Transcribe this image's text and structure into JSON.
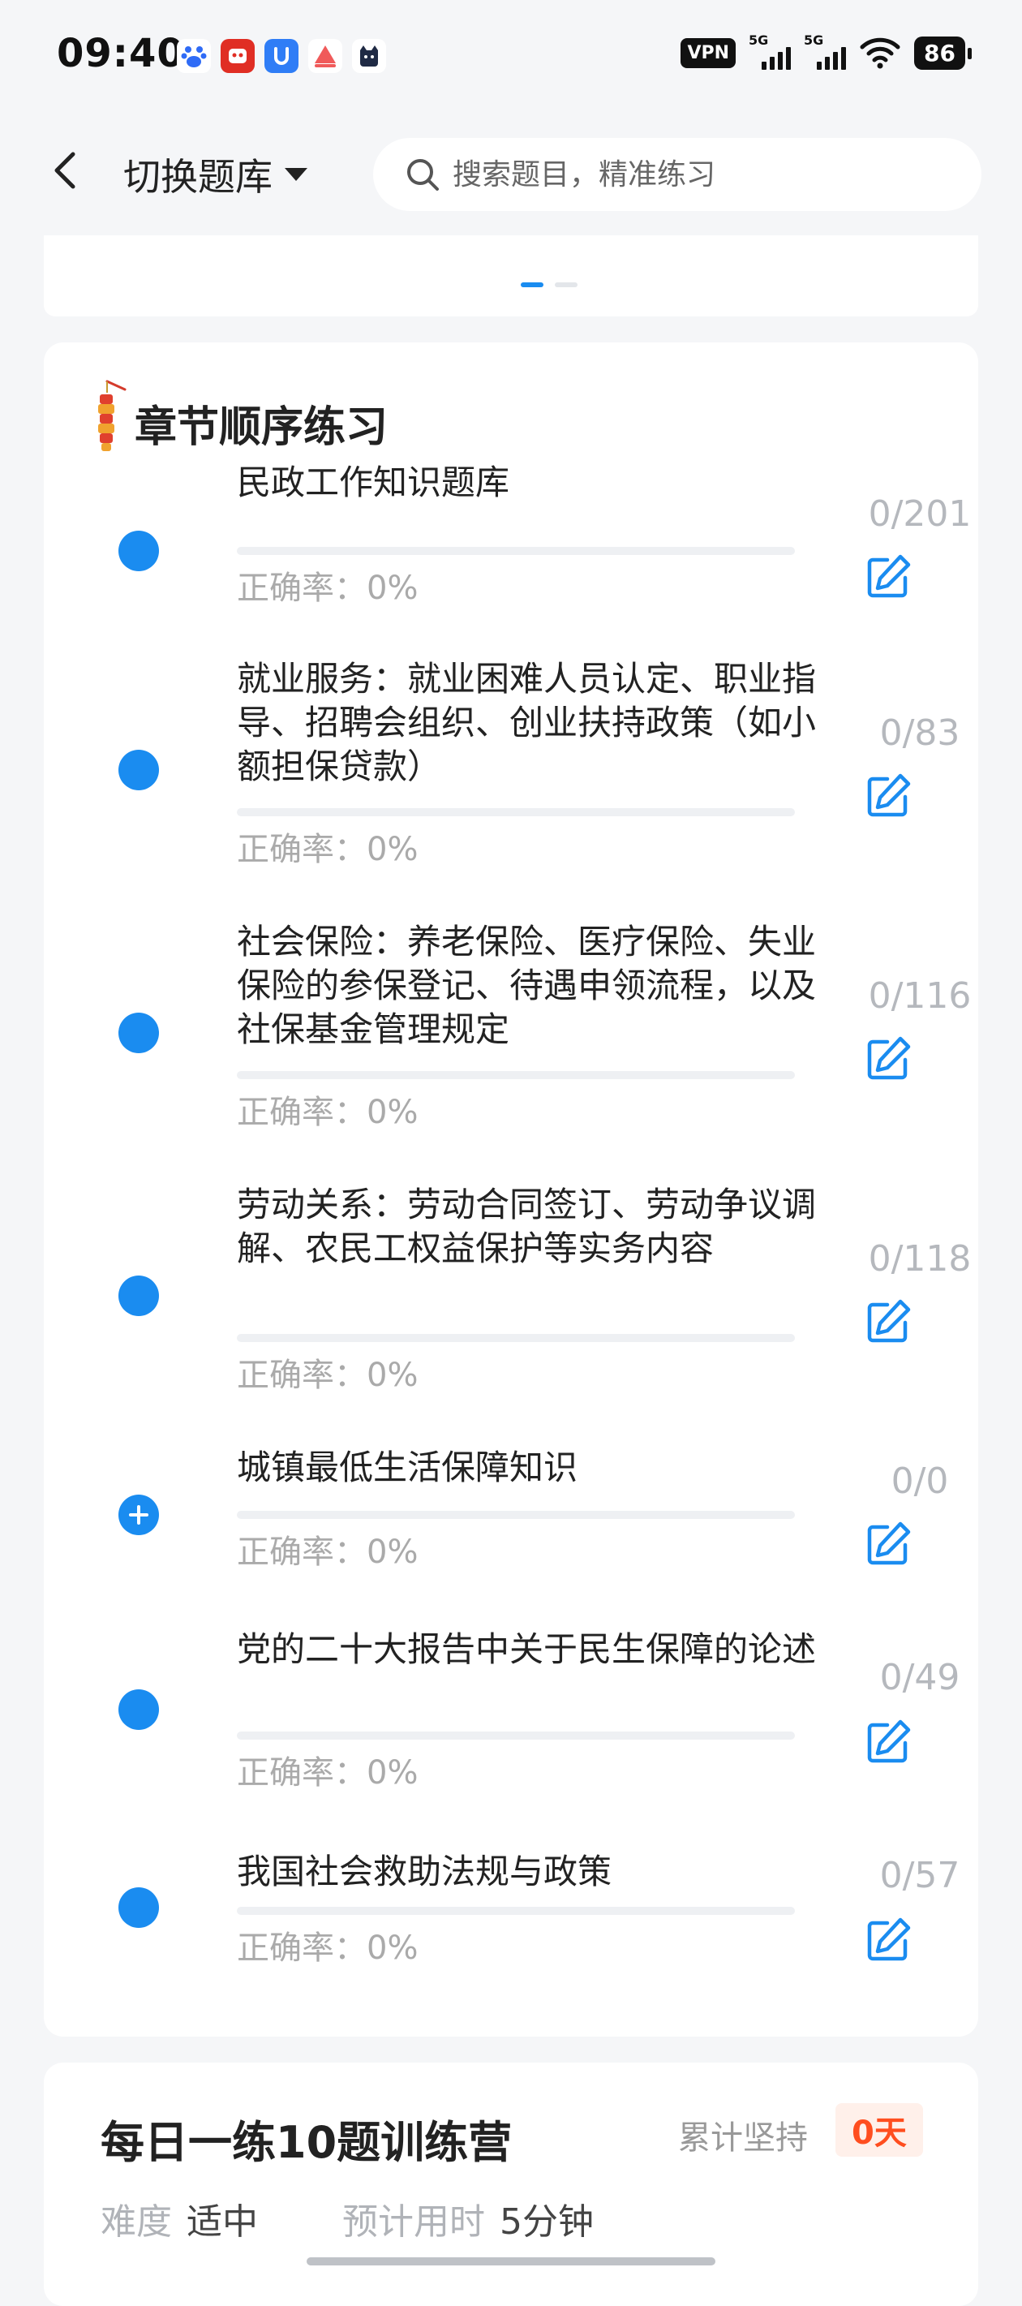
{
  "status_bar": {
    "time": "09:40",
    "vpn": "VPN",
    "signal_1": "5G",
    "signal_2": "5G",
    "battery": "86",
    "app_icons": [
      "baidu-icon",
      "pinduoduo-icon",
      "uc-icon",
      "triangle-app-icon",
      "cat-app-icon"
    ]
  },
  "header": {
    "switch_label": "切换题库",
    "search_placeholder": "搜索题目，精准练习"
  },
  "carousel": {
    "active_index": 0,
    "count": 2
  },
  "chapter_section": {
    "title": "章节顺序练习",
    "accuracy_label": "正确率：",
    "items": [
      {
        "title": "民政工作知识题库",
        "accuracy": "0%",
        "done": "0",
        "total": "201",
        "count": "0/201",
        "progress": 0,
        "icon": "dot"
      },
      {
        "title": "就业服务：就业困难人员认定、职业指导、招聘会组织、创业扶持政策（如小额担保贷款）",
        "accuracy": "0%",
        "done": "0",
        "total": "83",
        "count": "0/83",
        "progress": 0,
        "icon": "dot"
      },
      {
        "title": "社会保险：养老保险、医疗保险、失业保险的参保登记、待遇申领流程，以及社保基金管理规定",
        "accuracy": "0%",
        "done": "0",
        "total": "116",
        "count": "0/116",
        "progress": 0,
        "icon": "dot"
      },
      {
        "title": "劳动关系：劳动合同签订、劳动争议调解、农民工权益保护等实务内容",
        "accuracy": "0%",
        "done": "0",
        "total": "118",
        "count": "0/118",
        "progress": 0,
        "icon": "dot"
      },
      {
        "title": "城镇最低生活保障知识",
        "accuracy": "0%",
        "done": "0",
        "total": "0",
        "count": "0/0",
        "progress": 0,
        "icon": "plus"
      },
      {
        "title": "党的二十大报告中关于民生保障的论述",
        "accuracy": "0%",
        "done": "0",
        "total": "49",
        "count": "0/49",
        "progress": 0,
        "icon": "dot"
      },
      {
        "title": "我国社会救助法规与政策",
        "accuracy": "0%",
        "done": "0",
        "total": "57",
        "count": "0/57",
        "progress": 0,
        "icon": "dot"
      }
    ]
  },
  "camp": {
    "title": "每日一练10题训练营",
    "persist_label": "累计坚持",
    "persist_days": "0天",
    "difficulty_label": "难度",
    "difficulty_value": "适中",
    "time_label": "预计用时",
    "time_value": "5分钟"
  },
  "colors": {
    "accent": "#1a8cf0",
    "badge_text": "#ff4e1f",
    "badge_bg": "#fff0ea"
  }
}
